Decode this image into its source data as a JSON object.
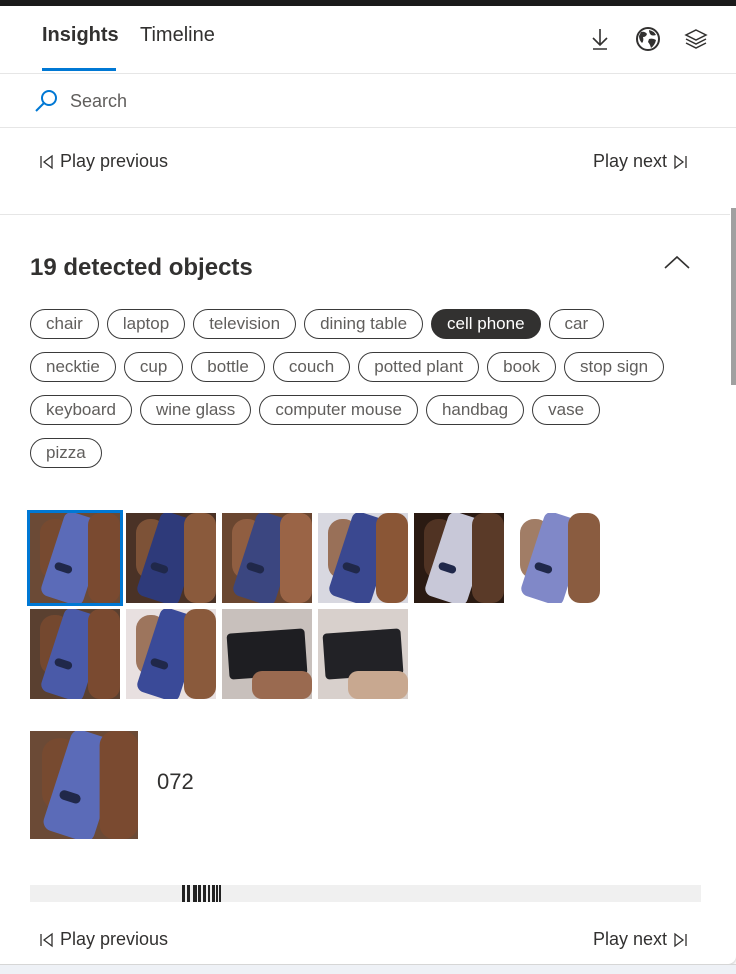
{
  "tabs": [
    {
      "label": "Insights",
      "active": true
    },
    {
      "label": "Timeline",
      "active": false
    }
  ],
  "header_icons": [
    "download-icon",
    "globe-icon",
    "layers-icon"
  ],
  "search": {
    "placeholder": "Search",
    "value": ""
  },
  "nav": {
    "play_previous": "Play previous",
    "play_next": "Play next"
  },
  "section": {
    "title": "19 detected objects",
    "expanded": true
  },
  "chip_rows": [
    [
      {
        "label": "chair"
      },
      {
        "label": "laptop"
      },
      {
        "label": "television"
      },
      {
        "label": "dining table"
      },
      {
        "label": "cell phone",
        "selected": true
      },
      {
        "label": "car"
      }
    ],
    [
      {
        "label": "necktie"
      },
      {
        "label": "cup"
      },
      {
        "label": "bottle"
      },
      {
        "label": "couch"
      },
      {
        "label": "potted plant"
      },
      {
        "label": "book"
      },
      {
        "label": "stop sign"
      }
    ],
    [
      {
        "label": "keyboard"
      },
      {
        "label": "wine glass"
      },
      {
        "label": "computer mouse"
      },
      {
        "label": "handbag"
      },
      {
        "label": "vase"
      }
    ],
    [
      {
        "label": "pizza"
      }
    ]
  ],
  "thumbnails": {
    "count": 10,
    "selected_index": 0,
    "description": "cell phone detection crops"
  },
  "preview": {
    "id": "072"
  },
  "colors": {
    "accent": "#0078d4",
    "chip_selected_bg": "#323130",
    "text": "#323130"
  }
}
